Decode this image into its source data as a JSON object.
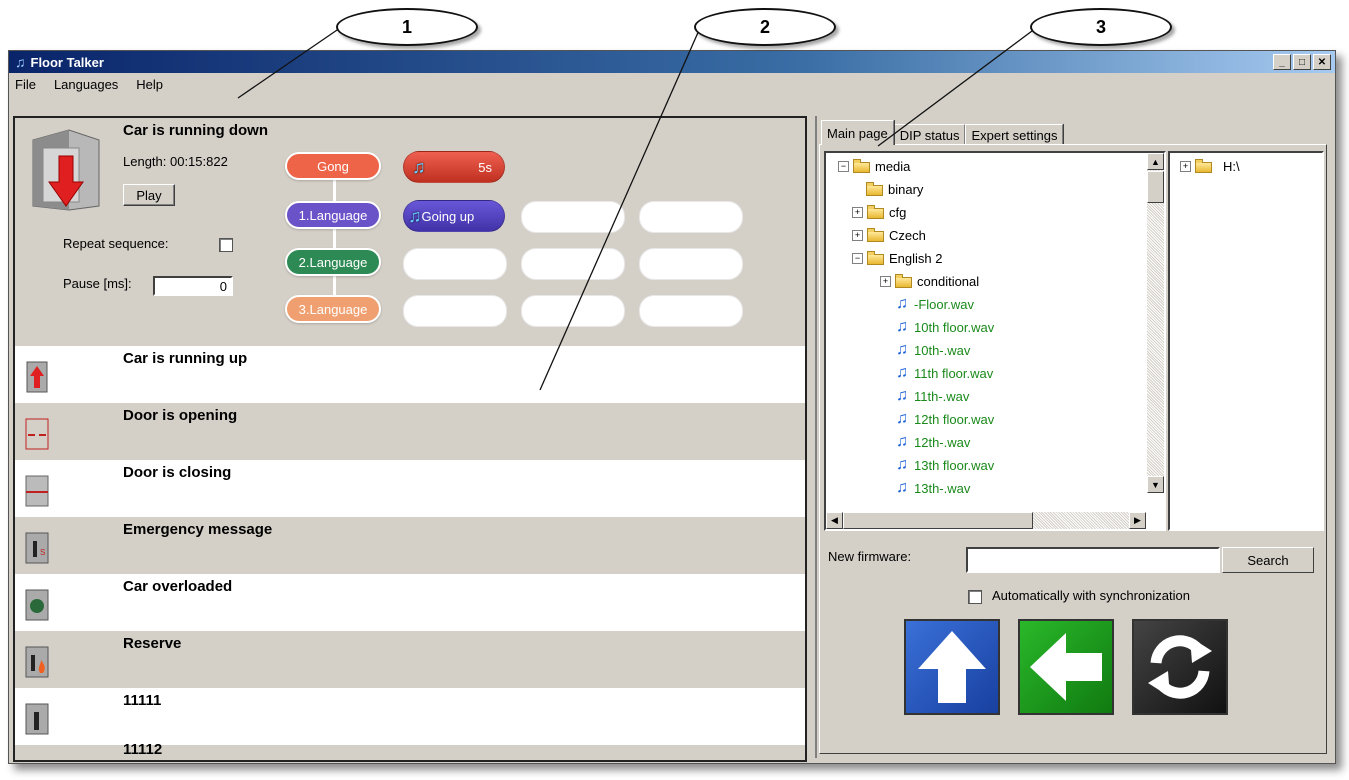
{
  "callouts": [
    "1",
    "2",
    "3"
  ],
  "window": {
    "title": "Floor Talker",
    "controls": {
      "minimize": "_",
      "maximize": "□",
      "close": "✕"
    }
  },
  "menu": {
    "file": "File",
    "languages": "Languages",
    "help": "Help"
  },
  "sequence": {
    "title": "Car is running down",
    "length": "Length: 00:15:822",
    "play_label": "Play",
    "repeat_label": "Repeat sequence:",
    "repeat_checked": false,
    "pause_label": "Pause [ms]:",
    "pause_value": "0",
    "nodes": [
      {
        "label": "Gong",
        "color": "#ee6448"
      },
      {
        "label": "1.Language",
        "color": "#6a52c8"
      },
      {
        "label": "2.Language",
        "color": "#2e8a55"
      },
      {
        "label": "3.Language",
        "color": "#f0a070"
      }
    ],
    "clips": [
      {
        "label": "5s",
        "color": "#d44030"
      },
      {
        "label": "Going up",
        "color": "#5242b8"
      }
    ]
  },
  "messages": [
    {
      "title": "Car is running up",
      "icon": "car-up-icon"
    },
    {
      "title": "Door is opening",
      "icon": "door-opening-icon"
    },
    {
      "title": "Door is closing",
      "icon": "door-closing-icon"
    },
    {
      "title": "Emergency message",
      "icon": "sos-icon"
    },
    {
      "title": "Car overloaded",
      "icon": "overload-icon"
    },
    {
      "title": "Reserve",
      "icon": "fire-icon"
    },
    {
      "title": "11111",
      "icon": "car-person-icon"
    },
    {
      "title": "11112",
      "icon": "car-person-icon"
    }
  ],
  "tabs": [
    "Main page",
    "DIP status",
    "Expert settings"
  ],
  "tree": {
    "root": "media",
    "items": [
      {
        "label": "media",
        "type": "folder",
        "level": 0,
        "expander": "−"
      },
      {
        "label": "binary",
        "type": "folder",
        "level": 1,
        "expander": ""
      },
      {
        "label": "cfg",
        "type": "folder",
        "level": 1,
        "expander": "+"
      },
      {
        "label": "Czech",
        "type": "folder",
        "level": 1,
        "expander": "+"
      },
      {
        "label": "English 2",
        "type": "folder",
        "level": 1,
        "expander": "−"
      },
      {
        "label": "conditional",
        "type": "folder",
        "level": 2,
        "expander": "+"
      },
      {
        "label": "-Floor.wav",
        "type": "wav",
        "level": 2
      },
      {
        "label": "10th floor.wav",
        "type": "wav",
        "level": 2
      },
      {
        "label": "10th-.wav",
        "type": "wav",
        "level": 2
      },
      {
        "label": "11th floor.wav",
        "type": "wav",
        "level": 2
      },
      {
        "label": "11th-.wav",
        "type": "wav",
        "level": 2
      },
      {
        "label": "12th floor.wav",
        "type": "wav",
        "level": 2
      },
      {
        "label": "12th-.wav",
        "type": "wav",
        "level": 2
      },
      {
        "label": "13th floor.wav",
        "type": "wav",
        "level": 2
      },
      {
        "label": "13th-.wav",
        "type": "wav",
        "level": 2
      }
    ]
  },
  "drive_tree": {
    "label": "H:\\",
    "expander": "+"
  },
  "firmware": {
    "label": "New firmware:",
    "value": "",
    "search_label": "Search",
    "auto_label": "Automatically with synchronization",
    "auto_checked": false
  },
  "actions": [
    {
      "icon": "upload-arrow-icon",
      "color": "#2050b8"
    },
    {
      "icon": "back-arrow-icon",
      "color": "#1a9a1a"
    },
    {
      "icon": "sync-icon",
      "color": "#222222"
    }
  ]
}
